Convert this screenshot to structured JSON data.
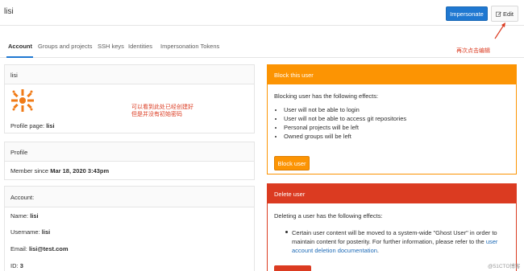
{
  "header": {
    "username": "lisi",
    "impersonate_label": "Impersonate",
    "edit_label": "Edit"
  },
  "tabs": [
    {
      "label": "Account"
    },
    {
      "label": "Groups and projects"
    },
    {
      "label": "SSH keys"
    },
    {
      "label": "Identities"
    },
    {
      "label": "Impersonation Tokens"
    }
  ],
  "annotations": {
    "edit_hint": "再次点击编辑",
    "avatar_note_line1": "可以看到此处已经创建好",
    "avatar_note_line2": "但是并没有初始密码"
  },
  "profile_card": {
    "title": "lisi",
    "profile_page_label": "Profile page:",
    "profile_page_value": "lisi"
  },
  "profile_info_card": {
    "title": "Profile",
    "member_since_label": "Member since",
    "member_since_value": "Mar 18, 2020 3:43pm"
  },
  "account_card": {
    "title": "Account:",
    "name_label": "Name:",
    "name_value": "lisi",
    "username_label": "Username:",
    "username_value": "lisi",
    "email_label": "Email:",
    "email_value": "lisi@test.com",
    "id_label": "ID:",
    "id_value": "3"
  },
  "block_card": {
    "title": "Block this user",
    "effects_intro": "Blocking user has the following effects:",
    "effects": [
      "User will not be able to login",
      "User will not be able to access git repositories",
      "Personal projects will be left",
      "Owned groups will be left"
    ],
    "button_label": "Block user"
  },
  "delete_card": {
    "title": "Delete user",
    "effects_intro": "Deleting a user has the following effects:",
    "effect_text": "Certain user content will be moved to a system-wide \"Ghost User\" in order to maintain content for posterity. For further information, please refer to the ",
    "effect_link": "user account deletion documentation",
    "effect_end": "."
  },
  "watermark": "@51CTO博客",
  "colors": {
    "primary": "#1f78d1",
    "warning": "#fc9403",
    "danger": "#db3b21"
  }
}
